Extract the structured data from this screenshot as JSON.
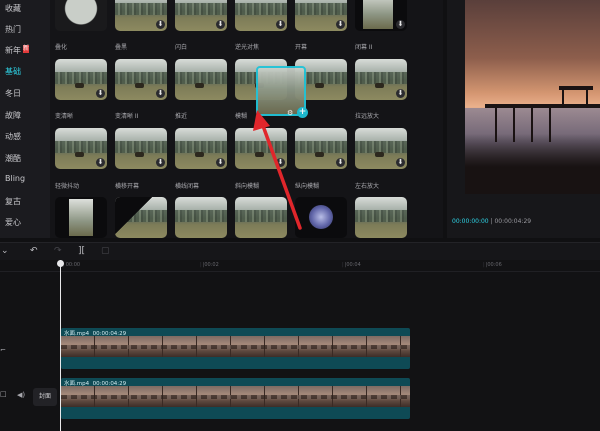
{
  "sidebar": {
    "items": [
      {
        "label": "收藏",
        "active": false,
        "badge": ""
      },
      {
        "label": "热门",
        "active": false,
        "badge": ""
      },
      {
        "label": "新年",
        "active": false,
        "badge": "新"
      },
      {
        "label": "基础",
        "active": true,
        "badge": ""
      },
      {
        "label": "冬日",
        "active": false,
        "badge": ""
      },
      {
        "label": "故障",
        "active": false,
        "badge": ""
      },
      {
        "label": "动感",
        "active": false,
        "badge": ""
      },
      {
        "label": "潮酷",
        "active": false,
        "badge": ""
      },
      {
        "label": "Bling",
        "active": false,
        "badge": ""
      },
      {
        "label": "复古",
        "active": false,
        "badge": ""
      },
      {
        "label": "爱心",
        "active": false,
        "badge": ""
      }
    ]
  },
  "transitions": {
    "row1": [
      "叠化",
      "叠黑",
      "闪白",
      "逆光对焦",
      "开幕",
      "闭幕 II"
    ],
    "row2": [
      "变清晰",
      "变清晰 II",
      "推近",
      "模糊",
      "",
      "拉远放大"
    ],
    "row3": [
      "轻微抖动",
      "横移开幕",
      "横线闭幕",
      "斜向模糊",
      "纵向模糊",
      "左右放大"
    ],
    "download_icon": "download-icon"
  },
  "drag_preview": {
    "plus_label": "+",
    "settings_icon": "gear-icon"
  },
  "preview": {
    "current_time": "00:00:00:00",
    "duration": "00:00:04:29"
  },
  "toolbar": {
    "icons": [
      "undo-icon",
      "redo-icon",
      "split-icon",
      "delete-icon"
    ]
  },
  "timeline": {
    "ruler_labels": [
      "00:00",
      "|00:02",
      "|00:04",
      "|00:06"
    ],
    "clips": [
      {
        "name": "水面.mp4",
        "duration": "00:00:04:29"
      },
      {
        "name": "水面.mp4",
        "duration": "00:00:04:29"
      }
    ],
    "cover_label": "封面"
  },
  "colors": {
    "accent": "#2ed3e6",
    "clip": "#0e4a55",
    "annotation_arrow": "#e0262b"
  }
}
